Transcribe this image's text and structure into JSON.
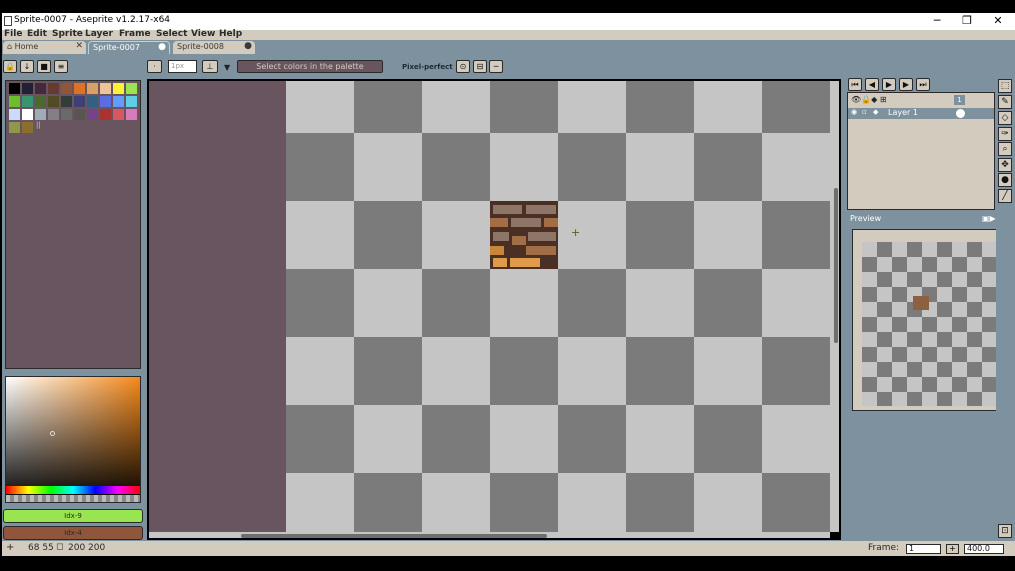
{
  "window": {
    "title": "Sprite-0007 - Aseprite v1.2.17-x64",
    "minimize": "─",
    "restore": "❐",
    "close": "✕"
  },
  "menu": [
    "File",
    "Edit",
    "Sprite",
    "Layer",
    "Frame",
    "Select",
    "View",
    "Help"
  ],
  "tabs": [
    {
      "label": "Home",
      "state": "inactive",
      "close": "✕"
    },
    {
      "label": "Sprite-0007",
      "state": "active",
      "close": "●"
    },
    {
      "label": "Sprite-0008",
      "state": "inactive",
      "close": "●"
    }
  ],
  "context_bar": {
    "hint": "Select colors in the palette",
    "pixel_perfect_label": "Pixel-perfect",
    "brush_size": "1px"
  },
  "palette": {
    "colors": [
      "#000000",
      "#222034",
      "#45283c",
      "#663931",
      "#8f563b",
      "#df7126",
      "#d9a066",
      "#eec39a",
      "#fbf236",
      "#99e550",
      "#6abe30",
      "#37946e",
      "#4b692f",
      "#524b24",
      "#323c39",
      "#3f3f74",
      "#306082",
      "#5b6ee1",
      "#639bff",
      "#5fcde4",
      "#cbdbfc",
      "#ffffff",
      "#9badb7",
      "#847e87",
      "#696a6a",
      "#595652",
      "#76428a",
      "#ac3232",
      "#d95763",
      "#d77bba",
      "#8f974a",
      "#8a6f30"
    ],
    "selected_label": "||"
  },
  "color_bar": {
    "fg_label": "Idx-9",
    "fg_color": "#99e550",
    "bg_label": "Idx-4",
    "bg_color": "#8f563b",
    "picker_base": "#f58a1a"
  },
  "timeline": {
    "frame_header": "1",
    "layers": [
      {
        "name": "Layer 1"
      }
    ]
  },
  "preview": {
    "title": "Preview"
  },
  "status": {
    "coords": "68 55",
    "size": "200 200",
    "frame_label": "Frame:",
    "frame_value": "1",
    "zoom": "400.0"
  },
  "tools": [
    "marquee-icon",
    "pencil-icon",
    "eraser-icon",
    "eyedropper-icon",
    "zoom-icon",
    "move-icon",
    "bucket-icon",
    "line-icon"
  ]
}
